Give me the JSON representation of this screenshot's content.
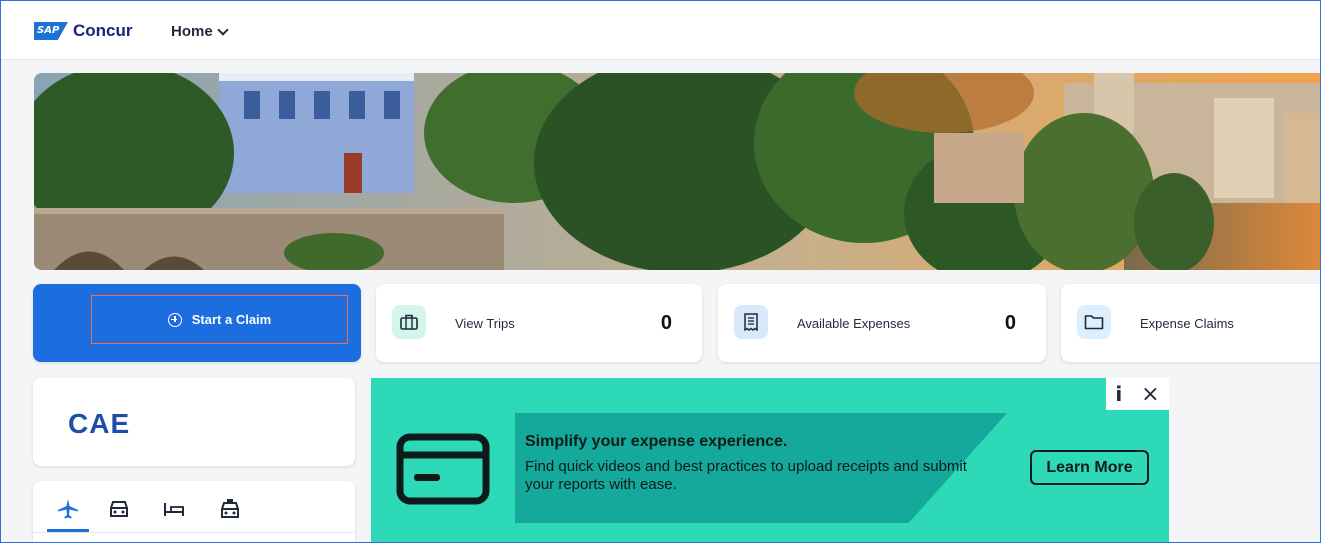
{
  "header": {
    "logo_badge": "SAP",
    "logo_text": "Concur",
    "home_label": "Home"
  },
  "tiles": {
    "start_claim_label": "Start a Claim",
    "view_trips_label": "View Trips",
    "view_trips_count": "0",
    "available_expenses_label": "Available Expenses",
    "available_expenses_count": "0",
    "expense_claims_label": "Expense Claims"
  },
  "company": {
    "logo_text": "CAE"
  },
  "travel_tabs": [
    "flight-icon",
    "car-icon",
    "hotel-icon",
    "taxi-icon"
  ],
  "promo": {
    "info": "i",
    "close": "×",
    "title": "Simplify your expense experience.",
    "text": "Find quick videos and best practices to upload receipts and submit your reports with ease.",
    "button": "Learn More"
  },
  "colors": {
    "brand_blue": "#1b6de0",
    "promo_teal": "#2ed9b8",
    "promo_dark_teal": "#14a99a",
    "trips_icon_bg": "#d2f5ec",
    "expenses_icon_bg": "#d8e9fb",
    "claims_icon_bg": "#dceffd"
  }
}
